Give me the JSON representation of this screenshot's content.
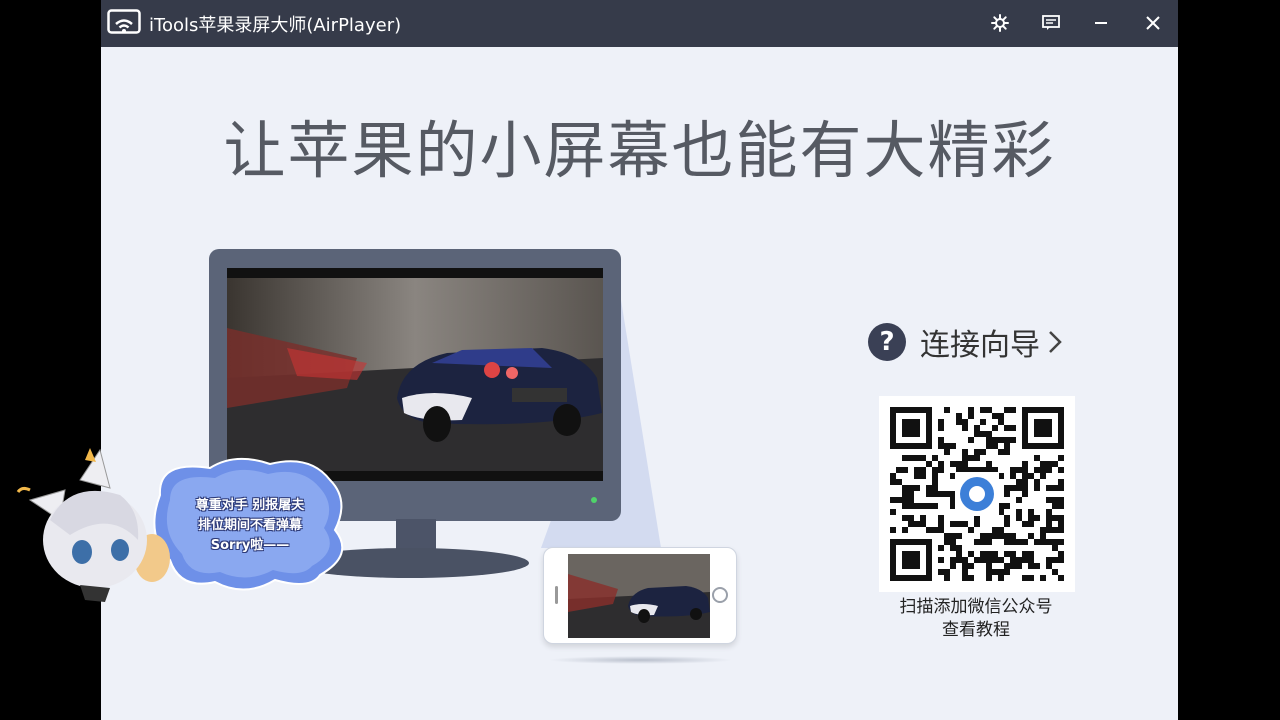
{
  "window": {
    "title": "iTools苹果录屏大师(AirPlayer)",
    "icons": {
      "app": "wifi-screen-icon",
      "settings": "gear-icon",
      "feedback": "message-icon",
      "minimize": "minimize-icon",
      "close": "close-icon"
    }
  },
  "main": {
    "headline": "让苹果的小屏幕也能有大精彩",
    "guide": {
      "label": "连接向导",
      "icon": "help-icon",
      "chevron": "chevron-right-icon"
    },
    "qr": {
      "caption_line1": "扫描添加微信公众号",
      "caption_line2": "查看教程"
    }
  },
  "overlay": {
    "bubble_lines": [
      "尊重对手 别报屠夫",
      "排位期间不看弹幕",
      "Sorry啦——"
    ]
  },
  "colors": {
    "titlebar": "#363b4a",
    "background": "#eef1f8",
    "monitor": "#5b6478",
    "accent": "#3a4055"
  }
}
